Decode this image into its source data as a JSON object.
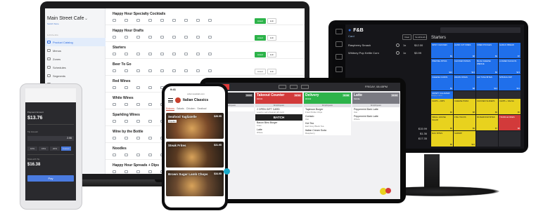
{
  "laptop": {
    "store_name": "Main Street Cafe",
    "store_sub": "Switch Store",
    "section_label": "CATALOG",
    "nav": [
      {
        "label": "Product Catalog",
        "active": true
      },
      {
        "label": "Menus"
      },
      {
        "label": "Zones"
      },
      {
        "label": "Schedules"
      },
      {
        "label": "Segments"
      },
      {
        "label": "Rules"
      }
    ],
    "categories": [
      {
        "title": "Happy Hour Specialty Cocktails",
        "published": true
      },
      {
        "title": "Happy Hour Drafts",
        "published": true
      },
      {
        "title": "Starters",
        "published": true
      },
      {
        "title": "Beer To Go",
        "published": false
      },
      {
        "title": "Red Wines",
        "published": true
      },
      {
        "title": "White Wines",
        "published": true
      },
      {
        "title": "Sparkling Wines",
        "published": true
      },
      {
        "title": "Wine by the Bottle",
        "published": true
      },
      {
        "title": "Noodles",
        "published": true
      },
      {
        "title": "Happy Hour Spreads + Dips",
        "published": true
      }
    ],
    "btn_live": "Listed",
    "btn_edit": "Edit"
  },
  "pos": {
    "logo": "F&B",
    "card_label": "Card",
    "order_lines": [
      {
        "name": "Raspberry Smash",
        "qty": "1x",
        "price": "$12.00"
      },
      {
        "name": "Whitney Pop Kettle Corn",
        "qty": "1x",
        "price": "$3.99"
      }
    ],
    "top_buttons": [
      "Clear",
      "Send/Hold"
    ],
    "category": "Starters",
    "tiles": [
      {
        "name": "SPICY CHICKEN",
        "price": "$9",
        "color": "blue"
      },
      {
        "name": "HAND CUT FRIES",
        "price": "$8",
        "color": "blue"
      },
      {
        "name": "FRIED PICKLES",
        "price": "$9",
        "color": "blue"
      },
      {
        "name": "GARLIC BREAD",
        "price": "$7",
        "color": "blue"
      },
      {
        "name": "PRETZEL BITES",
        "price": "$10",
        "color": "blue"
      },
      {
        "name": "CHICKEN WINGS",
        "price": "$12",
        "color": "blue"
      },
      {
        "name": "BLUE CHEESE WEDGE",
        "price": "$9",
        "color": "blue"
      },
      {
        "name": "LOADED NACHOS",
        "price": "$13",
        "color": "blue"
      },
      {
        "name": "CHEESE CURDS",
        "price": "$9",
        "color": "blue"
      },
      {
        "name": "ONION RINGS",
        "price": "$8",
        "color": "blue"
      },
      {
        "name": "AHI TUNA BITES",
        "price": "$14",
        "color": "blue"
      },
      {
        "name": "SPINACH DIP",
        "price": "$11",
        "color": "blue"
      },
      {
        "name": "CRISPY CALAMARI",
        "price": "$13",
        "color": "blue"
      },
      {
        "name": "",
        "price": "",
        "color": "dark"
      },
      {
        "name": "",
        "price": "",
        "color": "dark"
      },
      {
        "name": "",
        "price": "",
        "color": "dark"
      }
    ],
    "subheading": "Happy Hour",
    "tiles2": [
      {
        "name": "CHIPS + DIPS",
        "price": "$6",
        "color": "yellow"
      },
      {
        "name": "CHEESE PIZZA",
        "price": "$8",
        "color": "yellow"
      },
      {
        "name": "CHICKEN SLIDERS",
        "price": "$9",
        "color": "yellow"
      },
      {
        "name": "CHIPS + SALSA",
        "price": "$5",
        "color": "yellow"
      },
      {
        "name": "SMALL HOUSE SALAD",
        "price": "$6",
        "color": "yellow"
      },
      {
        "name": "FISH TACOS",
        "price": "$9",
        "color": "yellow"
      },
      {
        "name": "MUSHROOM BITES",
        "price": "$7",
        "color": "yellow"
      },
      {
        "name": "TRUFFLE FRIES",
        "price": "$8",
        "color": "red"
      },
      {
        "name": "MAC BITES",
        "price": "$6",
        "color": "yellow"
      },
      {
        "name": "SHRIMP",
        "price": "$10",
        "color": "yellow"
      },
      {
        "name": "",
        "price": "",
        "color": "dark"
      },
      {
        "name": "",
        "price": "",
        "color": "dark"
      }
    ],
    "totals": [
      {
        "label": "Subtotal",
        "value": "$15.99"
      },
      {
        "label": "Tax",
        "value": "$1.36"
      },
      {
        "label": "Total",
        "value": "$17.35"
      }
    ]
  },
  "kds": {
    "time": "FRIDAY, 08:45PM",
    "columns": [
      {
        "title": "Dine In",
        "sub": "Table 12",
        "badge": "04:37",
        "color": "#2a2a2e",
        "section": "Employees",
        "items": [
          {
            "name": "2019 Aragon 164",
            "mod": ""
          }
        ]
      },
      {
        "title": "Takeout Counter",
        "sub": "#2341",
        "badge": "02:12",
        "color": "#d23a3a",
        "section": "Employees",
        "items": [
          {
            "name": "2 OPEN GIFT CARD",
            "mod": "Load to sell physical gift card"
          },
          {
            "name": "Bacon Bleu Burger",
            "mod": "Fries"
          },
          {
            "name": "Latte",
            "mod": "Whole"
          }
        ],
        "batch": "BATCH"
      },
      {
        "title": "Delivery",
        "sub": "#2342",
        "badge": "01:08",
        "color": "#2db34a",
        "section": "Employees",
        "items": [
          {
            "name": "Tapinson Burger",
            "mod": "Fried Pickle Chips"
          },
          {
            "name": "Cortado",
            "mod": "Oat"
          },
          {
            "name": "Hot Tea",
            "mod": "Earl Grey Black Tea"
          },
          {
            "name": "Italian Cream Soda",
            "mod": "Raspberry"
          }
        ]
      },
      {
        "title": "Latte",
        "sub": "Mobile",
        "badge": "00:40",
        "color": "#7a7a82",
        "section": "Employees",
        "items": [
          {
            "name": "Peppermint Bark Latte",
            "mod": "Oat"
          },
          {
            "name": "Peppermint Bark Latte",
            "mod": "Whole"
          }
        ]
      }
    ]
  },
  "payment": {
    "title": "Payment Amount",
    "total": "$13.76",
    "tip_label": "Tip Amount",
    "tip_value": "2.06",
    "chips": [
      "10%",
      "15%",
      "20%",
      "Custom"
    ],
    "new_total_label": "Total with Tip",
    "new_total": "$16.38",
    "pay_label": "Pay"
  },
  "mobile": {
    "time": "9:41",
    "url": "order.toasttab.com",
    "venue": "Italian Classics",
    "tabs": [
      "Entrees",
      "Salads",
      "Chicken",
      "Seafood"
    ],
    "active_tab": "Entrees",
    "cards": [
      {
        "name": "Seafood Tagliatelle",
        "price": "$26.95",
        "tag": "Popular",
        "img": "#7a4a2a"
      },
      {
        "name": "Steak Frites",
        "price": "$31.95",
        "tag": "",
        "img": "#5a3a22"
      },
      {
        "name": "Brown Sugar Lamb Chops",
        "price": "$34.95",
        "tag": "",
        "img": "#6b4a30"
      }
    ]
  }
}
